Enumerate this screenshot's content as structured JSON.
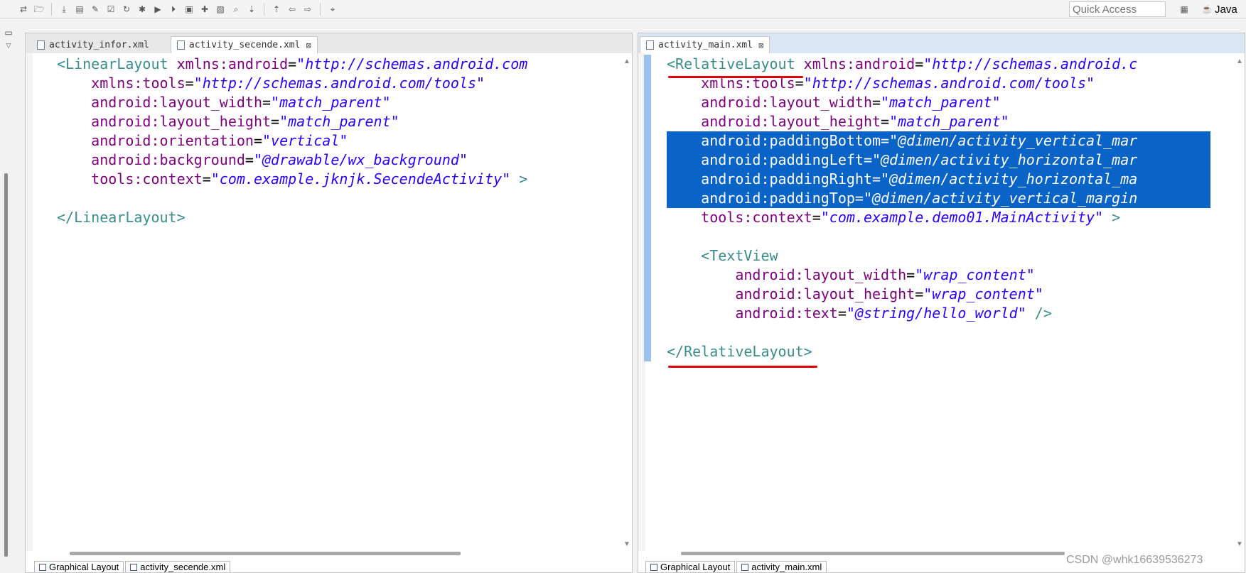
{
  "toolbar": {
    "quick_access_placeholder": "Quick Access",
    "perspective_label": "Java",
    "icons": [
      "toggle-icon",
      "open-icon",
      "download-icon",
      "sdk-icon",
      "wrench-icon",
      "checkbox-icon",
      "refresh-icon",
      "debug-icon",
      "run-icon",
      "run-ext-icon",
      "package-icon",
      "new-icon",
      "folder-icon",
      "search-tool-icon",
      "next-annotation-icon",
      "prev-annotation-icon",
      "back-icon",
      "forward-icon",
      "pin-icon"
    ]
  },
  "left_editor": {
    "tabs": [
      {
        "label": "activity_infor.xml",
        "active": false
      },
      {
        "label": "activity_secende.xml",
        "active": true
      }
    ],
    "bottom_tabs": [
      "Graphical Layout",
      "activity_secende.xml"
    ],
    "lines": [
      {
        "indent": "",
        "tokens": [
          {
            "t": "tag",
            "v": "<LinearLayout "
          },
          {
            "t": "attr",
            "v": "xmlns:android"
          },
          {
            "t": "eq",
            "v": "="
          },
          {
            "t": "val",
            "v": "\"http://schemas.android.com"
          }
        ]
      },
      {
        "indent": "    ",
        "tokens": [
          {
            "t": "attr",
            "v": "xmlns:tools"
          },
          {
            "t": "eq",
            "v": "="
          },
          {
            "t": "val",
            "v": "\"http://schemas.android.com/tools\""
          }
        ]
      },
      {
        "indent": "    ",
        "tokens": [
          {
            "t": "attr",
            "v": "android:layout_width"
          },
          {
            "t": "eq",
            "v": "="
          },
          {
            "t": "val",
            "v": "\"match_parent\""
          }
        ]
      },
      {
        "indent": "    ",
        "tokens": [
          {
            "t": "attr",
            "v": "android:layout_height"
          },
          {
            "t": "eq",
            "v": "="
          },
          {
            "t": "val",
            "v": "\"match_parent\""
          }
        ]
      },
      {
        "indent": "    ",
        "tokens": [
          {
            "t": "attr",
            "v": "android:orientation"
          },
          {
            "t": "eq",
            "v": "="
          },
          {
            "t": "val",
            "v": "\"vertical\""
          }
        ]
      },
      {
        "indent": "    ",
        "tokens": [
          {
            "t": "attr",
            "v": "android:background"
          },
          {
            "t": "eq",
            "v": "="
          },
          {
            "t": "val",
            "v": "\"@drawable/wx_background\""
          }
        ]
      },
      {
        "indent": "    ",
        "tokens": [
          {
            "t": "attr",
            "v": "tools:context"
          },
          {
            "t": "eq",
            "v": "="
          },
          {
            "t": "val",
            "v": "\"com.example.jknjk.SecendeActivity\""
          },
          {
            "t": "tag",
            "v": " >"
          }
        ]
      },
      {
        "indent": "",
        "tokens": []
      },
      {
        "indent": "",
        "tokens": [
          {
            "t": "tag",
            "v": "</LinearLayout>"
          }
        ]
      }
    ]
  },
  "right_editor": {
    "tabs": [
      {
        "label": "activity_main.xml",
        "active": true
      }
    ],
    "bottom_tabs": [
      "Graphical Layout",
      "activity_main.xml"
    ],
    "lines": [
      {
        "indent": "",
        "sel": false,
        "tokens": [
          {
            "t": "tag",
            "v": "<RelativeLayout "
          },
          {
            "t": "attr",
            "v": "xmlns:android"
          },
          {
            "t": "eq",
            "v": "="
          },
          {
            "t": "val",
            "v": "\"http://schemas.android.c"
          }
        ]
      },
      {
        "indent": "    ",
        "sel": false,
        "tokens": [
          {
            "t": "attr",
            "v": "xmlns:tools"
          },
          {
            "t": "eq",
            "v": "="
          },
          {
            "t": "val",
            "v": "\"http://schemas.android.com/tools\""
          }
        ]
      },
      {
        "indent": "    ",
        "sel": false,
        "tokens": [
          {
            "t": "attr",
            "v": "android:layout_width"
          },
          {
            "t": "eq",
            "v": "="
          },
          {
            "t": "val",
            "v": "\"match_parent\""
          }
        ]
      },
      {
        "indent": "    ",
        "sel": false,
        "tokens": [
          {
            "t": "attr",
            "v": "android:layout_height"
          },
          {
            "t": "eq",
            "v": "="
          },
          {
            "t": "val",
            "v": "\"match_parent\""
          }
        ]
      },
      {
        "indent": "    ",
        "sel": true,
        "tokens": [
          {
            "t": "attr",
            "v": "android:paddingBottom"
          },
          {
            "t": "eq",
            "v": "="
          },
          {
            "t": "val",
            "v": "\"@dimen/activity_vertical_mar"
          }
        ]
      },
      {
        "indent": "    ",
        "sel": true,
        "tokens": [
          {
            "t": "attr",
            "v": "android:paddingLeft"
          },
          {
            "t": "eq",
            "v": "="
          },
          {
            "t": "val",
            "v": "\"@dimen/activity_horizontal_mar"
          }
        ]
      },
      {
        "indent": "    ",
        "sel": true,
        "tokens": [
          {
            "t": "attr",
            "v": "android:paddingRight"
          },
          {
            "t": "eq",
            "v": "="
          },
          {
            "t": "val",
            "v": "\"@dimen/activity_horizontal_ma"
          }
        ]
      },
      {
        "indent": "    ",
        "sel": true,
        "tokens": [
          {
            "t": "attr",
            "v": "android:paddingTop"
          },
          {
            "t": "eq",
            "v": "="
          },
          {
            "t": "val",
            "v": "\"@dimen/activity_vertical_margin"
          }
        ]
      },
      {
        "indent": "    ",
        "sel": false,
        "tokens": [
          {
            "t": "attr",
            "v": "tools:context"
          },
          {
            "t": "eq",
            "v": "="
          },
          {
            "t": "val",
            "v": "\"com.example.demo01.MainActivity\""
          },
          {
            "t": "tag",
            "v": " >"
          }
        ]
      },
      {
        "indent": "",
        "sel": false,
        "tokens": []
      },
      {
        "indent": "    ",
        "sel": false,
        "tokens": [
          {
            "t": "tag",
            "v": "<TextView"
          }
        ]
      },
      {
        "indent": "        ",
        "sel": false,
        "tokens": [
          {
            "t": "attr",
            "v": "android:layout_width"
          },
          {
            "t": "eq",
            "v": "="
          },
          {
            "t": "val",
            "v": "\"wrap_content\""
          }
        ]
      },
      {
        "indent": "        ",
        "sel": false,
        "tokens": [
          {
            "t": "attr",
            "v": "android:layout_height"
          },
          {
            "t": "eq",
            "v": "="
          },
          {
            "t": "val",
            "v": "\"wrap_content\""
          }
        ]
      },
      {
        "indent": "        ",
        "sel": false,
        "tokens": [
          {
            "t": "attr",
            "v": "android:text"
          },
          {
            "t": "eq",
            "v": "="
          },
          {
            "t": "val",
            "v": "\"@string/hello_world\""
          },
          {
            "t": "tag",
            "v": " />"
          }
        ]
      },
      {
        "indent": "",
        "sel": false,
        "tokens": []
      },
      {
        "indent": "",
        "sel": false,
        "tokens": [
          {
            "t": "tag",
            "v": "</RelativeLayout>"
          }
        ]
      }
    ]
  },
  "watermark": "CSDN @whk16639536273",
  "colors": {
    "tag": "#3a8d8d",
    "attr": "#7f007f",
    "value": "#2a00ff",
    "selection": "#0a64c8",
    "annotation_underline": "#e00000"
  }
}
